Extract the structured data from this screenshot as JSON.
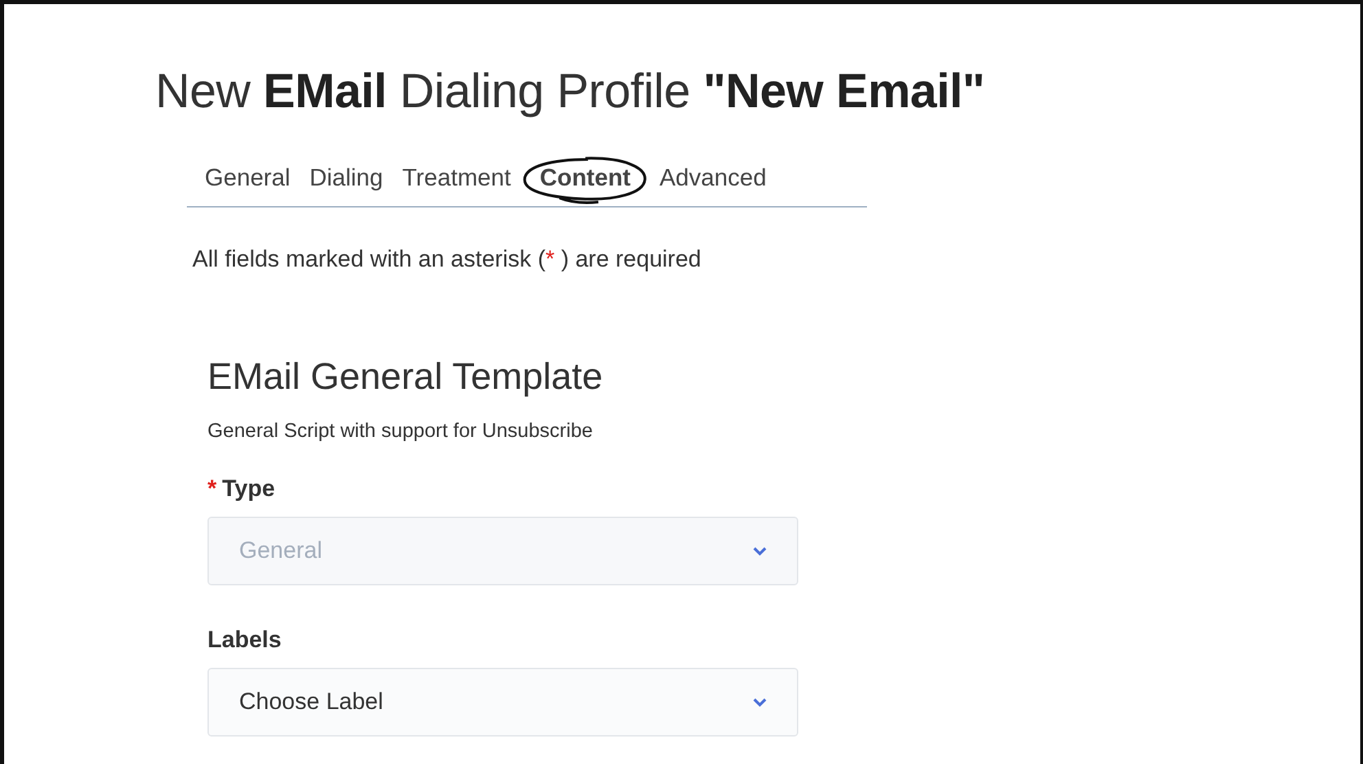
{
  "title": "New **EMail** Dialing Profile **\"New Email\"**",
  "tabs": [
    {
      "label": "General",
      "selected": false,
      "circled": false
    },
    {
      "label": "Dialing",
      "selected": false,
      "circled": false
    },
    {
      "label": "Treatment",
      "selected": false,
      "circled": false
    },
    {
      "label": "Content",
      "selected": true,
      "circled": true
    },
    {
      "label": "Advanced",
      "selected": false,
      "circled": false
    }
  ],
  "required_note": {
    "before": "All fields marked with an asterisk (",
    "mark": "*",
    "after": " ) are required"
  },
  "section": {
    "title": "EMail General Template",
    "description": "General Script with support for Unsubscribe"
  },
  "fields": [
    {
      "label": "Type",
      "marker": "*",
      "value": "General",
      "disabled": true
    },
    {
      "label": "Labels",
      "value": "Choose Label",
      "disabled": false
    }
  ]
}
